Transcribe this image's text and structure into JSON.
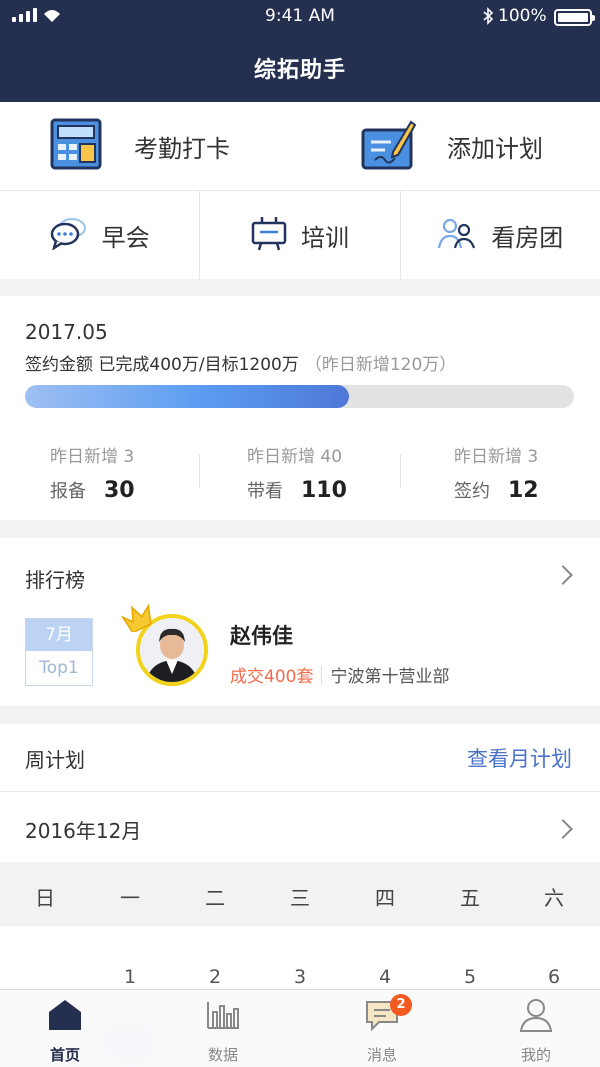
{
  "status": {
    "time": "9:41 AM",
    "battery": "100%"
  },
  "header": {
    "title": "综拓助手"
  },
  "quick": {
    "attendance": "考勤打卡",
    "add_plan": "添加计划",
    "morning_meeting": "早会",
    "training": "培训",
    "viewing_group": "看房团"
  },
  "stats": {
    "month": "2017.05",
    "goal_text": "签约金额 已完成400万/目标1200万",
    "goal_sub": "（昨日新增120万）",
    "progress": 0.59,
    "metrics": [
      {
        "yesterday": "昨日新增 3",
        "label": "报备",
        "value": "30"
      },
      {
        "yesterday": "昨日新增 40",
        "label": "带看",
        "value": "110"
      },
      {
        "yesterday": "昨日新增 3",
        "label": "签约",
        "value": "12"
      }
    ]
  },
  "ranking": {
    "title": "排行榜",
    "badge_month": "7月",
    "badge_rank": "Top1",
    "name": "赵伟佳",
    "deals": "成交400套",
    "department": "宁波第十营业部"
  },
  "plan": {
    "title": "周计划",
    "link": "查看月计划",
    "date": "2016年12月",
    "weekdays": [
      "日",
      "一",
      "二",
      "三",
      "四",
      "五",
      "六"
    ],
    "days": [
      "",
      "1",
      "2",
      "3",
      "4",
      "5",
      "6"
    ]
  },
  "tabs": [
    {
      "label": "首页",
      "icon": "home-icon",
      "active": true
    },
    {
      "label": "数据",
      "icon": "chart-icon"
    },
    {
      "label": "",
      "icon": "blank"
    },
    {
      "label": "消息",
      "icon": "message-icon",
      "badge": "2"
    },
    {
      "label": "我的",
      "icon": "user-icon"
    }
  ],
  "colors": {
    "header": "#253050",
    "accent": "#4a73c9",
    "deal": "#f36b4c",
    "badge": "#f25a22"
  }
}
